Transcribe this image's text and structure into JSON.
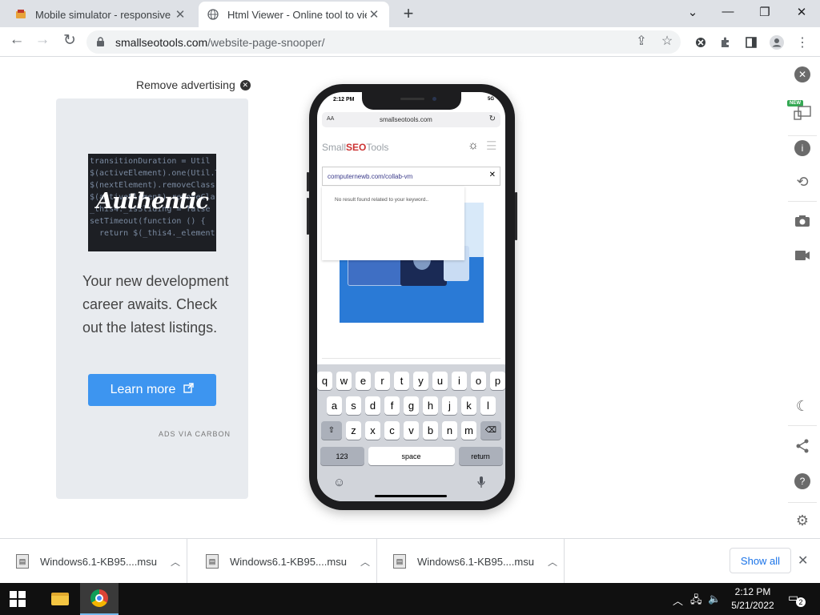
{
  "browser": {
    "tabs": [
      {
        "title": "Mobile simulator - responsive te",
        "active": false,
        "favicon": "simulator-favicon"
      },
      {
        "title": "Html Viewer - Online tool to view",
        "active": true,
        "favicon": "globe-icon"
      }
    ],
    "window_controls": {
      "minimize": "—",
      "maximize": "❐",
      "close": "✕"
    },
    "url": {
      "host": "smallseotools.com",
      "path": "/website-page-snooper/"
    }
  },
  "ad": {
    "remove_label": "Remove advertising",
    "image_brand": "Authentic",
    "image_code": "transitionDuration = Util\n$(activeElement).one(Util.T\n$(nextElement).removeClass\n$(activeElement).removeCla\n_this4._isSliding = false\nsetTimeout(function () {\n  return $(_this4._element",
    "text": "Your new development career awaits. Check out the latest listings.",
    "button_label": "Learn more",
    "via": "ADS VIA CARBON",
    "button_color": "#3d95f0"
  },
  "phone": {
    "status_time": "2:12 PM",
    "status_right": "5G",
    "url_aa": "AA",
    "url_host": "smallseotools.com",
    "logo_prefix": "Small",
    "logo_mid": "SEO",
    "logo_suffix": "Tools",
    "search_value": "computernewb.com/collab-vm",
    "dropdown_message": "No result found related to your keyword..",
    "keyboard": {
      "row1": [
        "q",
        "w",
        "e",
        "r",
        "t",
        "y",
        "u",
        "i",
        "o",
        "p"
      ],
      "row2": [
        "a",
        "s",
        "d",
        "f",
        "g",
        "h",
        "j",
        "k",
        "l"
      ],
      "row3": [
        "z",
        "x",
        "c",
        "v",
        "b",
        "n",
        "m"
      ],
      "numbers_key": "123",
      "space_key": "space",
      "return_key": "return",
      "shift_key": "⇧",
      "delete_key": "⌫"
    }
  },
  "sidebar": {
    "new_badge": "NEW",
    "icons": [
      "close-icon",
      "devices-icon",
      "info-icon",
      "rotate-icon",
      "camera-icon",
      "video-icon",
      "moon-icon",
      "share-icon",
      "help-icon",
      "settings-icon"
    ]
  },
  "downloads": {
    "items": [
      {
        "name": "Windows6.1-KB95....msu"
      },
      {
        "name": "Windows6.1-KB95....msu"
      },
      {
        "name": "Windows6.1-KB95....msu"
      }
    ],
    "show_all": "Show all"
  },
  "taskbar": {
    "time": "2:12 PM",
    "date": "5/21/2022",
    "notification_count": "2"
  }
}
